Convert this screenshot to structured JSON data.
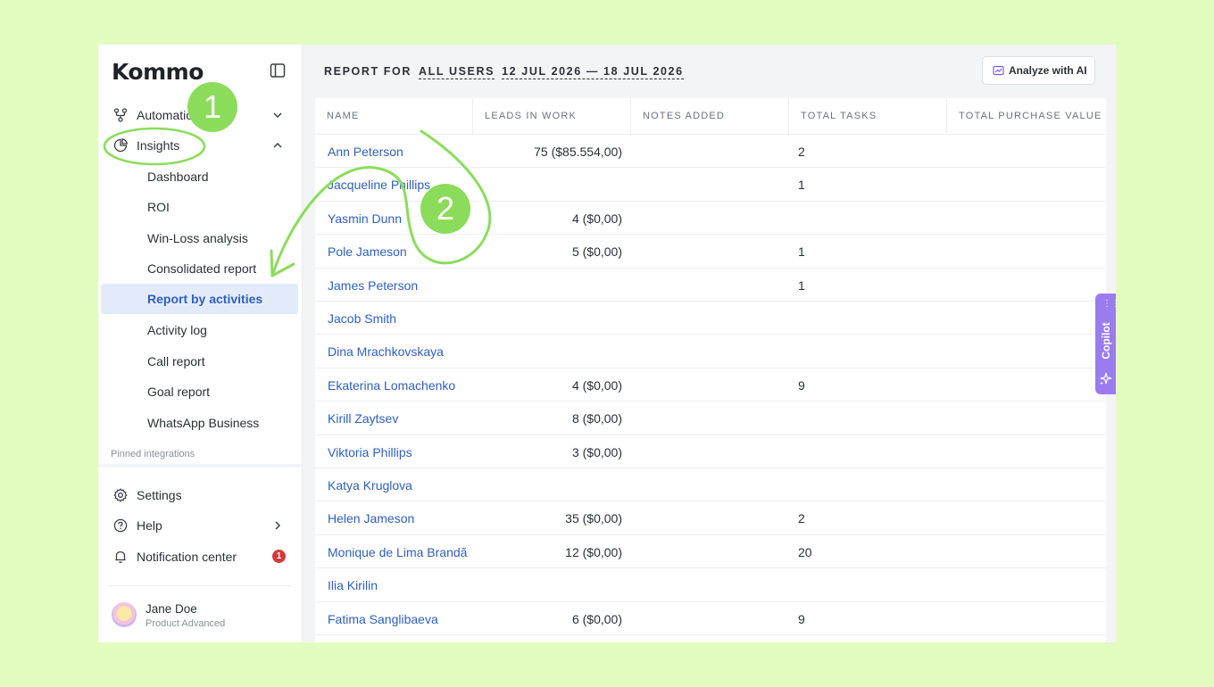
{
  "brand": {
    "logo": "Kommo"
  },
  "sidebar": {
    "automation": {
      "label": "Automation"
    },
    "insights": {
      "label": "Insights"
    },
    "sub_items": [
      {
        "label": "Dashboard"
      },
      {
        "label": "ROI"
      },
      {
        "label": "Win-Loss analysis"
      },
      {
        "label": "Consolidated report"
      },
      {
        "label": "Report by activities",
        "active": true
      },
      {
        "label": "Activity log"
      },
      {
        "label": "Call report"
      },
      {
        "label": "Goal report"
      },
      {
        "label": "WhatsApp Business"
      }
    ],
    "pinned_label": "Pinned integrations",
    "settings": {
      "label": "Settings"
    },
    "help": {
      "label": "Help"
    },
    "notifications": {
      "label": "Notification center",
      "badge": "1"
    },
    "user": {
      "name": "Jane Doe",
      "plan": "Product Advanced"
    }
  },
  "header": {
    "prefix": "REPORT FOR",
    "users": "ALL USERS",
    "range": "12 JUL 2026 — 18 JUL 2026",
    "analyze_label": "Analyze with AI"
  },
  "table": {
    "columns": [
      "NAME",
      "LEADS IN WORK",
      "NOTES ADDED",
      "TOTAL TASKS",
      "TOTAL PURCHASE VALUE"
    ],
    "rows": [
      {
        "name": "Ann Peterson",
        "leads": "75 ($85.554,00)",
        "tasks": "2"
      },
      {
        "name": "Jacqueline Phillips",
        "leads": "",
        "tasks": "1"
      },
      {
        "name": "Yasmin Dunn",
        "leads": "4 ($0,00)",
        "tasks": ""
      },
      {
        "name": "Pole Jameson",
        "leads": "5 ($0,00)",
        "tasks": "1"
      },
      {
        "name": "James Peterson",
        "leads": "",
        "tasks": "1"
      },
      {
        "name": "Jacob Smith",
        "leads": "",
        "tasks": ""
      },
      {
        "name": "Dina Mrachkovskaya",
        "leads": "",
        "tasks": ""
      },
      {
        "name": "Ekaterina Lomachenko",
        "leads": "4 ($0,00)",
        "tasks": "9"
      },
      {
        "name": "Kirill Zaytsev",
        "leads": "8 ($0,00)",
        "tasks": ""
      },
      {
        "name": "Viktoria Phillips",
        "leads": "3 ($0,00)",
        "tasks": ""
      },
      {
        "name": "Katya Kruglova",
        "leads": "",
        "tasks": ""
      },
      {
        "name": "Helen Jameson",
        "leads": "35 ($0,00)",
        "tasks": "2"
      },
      {
        "name": "Monique de Lima Brandã",
        "leads": "12 ($0,00)",
        "tasks": "20"
      },
      {
        "name": "Ilia Kirilin",
        "leads": "",
        "tasks": ""
      },
      {
        "name": "Fatima Sanglibaeva",
        "leads": "6 ($0,00)",
        "tasks": "9"
      }
    ]
  },
  "copilot": {
    "label": "Copilot"
  },
  "annotations": {
    "step1": "1",
    "step2": "2",
    "color": "#8bdc5b"
  }
}
